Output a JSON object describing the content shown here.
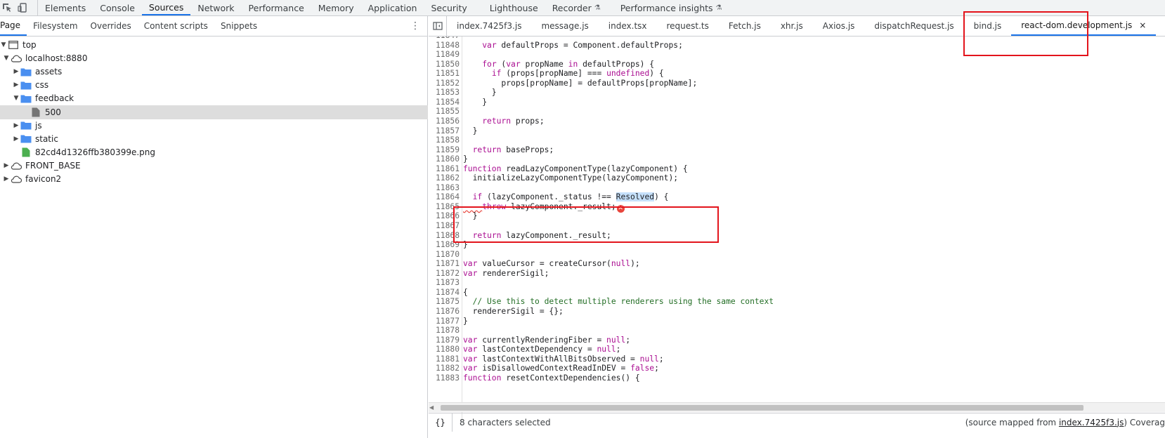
{
  "toolbar": {
    "tabs": [
      "Elements",
      "Console",
      "Sources",
      "Network",
      "Performance",
      "Memory",
      "Application",
      "Security",
      "Lighthouse",
      "Recorder",
      "Performance insights"
    ],
    "active_tab": "Sources",
    "accent": "#1a73e8"
  },
  "navigator": {
    "tabs": [
      "Page",
      "Filesystem",
      "Overrides",
      "Content scripts",
      "Snippets"
    ],
    "active_tab": "Page",
    "tree": [
      {
        "label": "top",
        "icon": "frame-icon",
        "expanded": true
      },
      {
        "label": "localhost:8880",
        "icon": "cloud-icon",
        "expanded": true
      },
      {
        "label": "assets",
        "icon": "folder-icon",
        "expanded": false
      },
      {
        "label": "css",
        "icon": "folder-icon",
        "expanded": false
      },
      {
        "label": "feedback",
        "icon": "folder-icon",
        "expanded": true
      },
      {
        "label": "500",
        "icon": "file-icon",
        "selected": true
      },
      {
        "label": "js",
        "icon": "folder-icon",
        "expanded": false
      },
      {
        "label": "static",
        "icon": "folder-icon",
        "expanded": false
      },
      {
        "label": "82cd4d1326ffb380399e.png",
        "icon": "image-file-icon"
      },
      {
        "label": "FRONT_BASE",
        "icon": "cloud-icon",
        "expanded": false
      },
      {
        "label": "favicon2",
        "icon": "cloud-icon",
        "expanded": false
      }
    ]
  },
  "editor": {
    "file_tabs": [
      "index.7425f3.js",
      "message.js",
      "index.tsx",
      "request.ts",
      "Fetch.js",
      "xhr.js",
      "Axios.js",
      "dispatchRequest.js",
      "bind.js",
      "react-dom.development.js"
    ],
    "active_file": "react-dom.development.js",
    "close_label": "×",
    "lines": [
      {
        "n": "11847",
        "code": ""
      },
      {
        "n": "11848",
        "code": "    var defaultProps = Component.defaultProps;"
      },
      {
        "n": "11849",
        "code": ""
      },
      {
        "n": "11850",
        "code": "    for (var propName in defaultProps) {"
      },
      {
        "n": "11851",
        "code": "      if (props[propName] === undefined) {"
      },
      {
        "n": "11852",
        "code": "        props[propName] = defaultProps[propName];"
      },
      {
        "n": "11853",
        "code": "      }"
      },
      {
        "n": "11854",
        "code": "    }"
      },
      {
        "n": "11855",
        "code": ""
      },
      {
        "n": "11856",
        "code": "    return props;"
      },
      {
        "n": "11857",
        "code": "  }"
      },
      {
        "n": "11858",
        "code": ""
      },
      {
        "n": "11859",
        "code": "  return baseProps;"
      },
      {
        "n": "11860",
        "code": "}"
      },
      {
        "n": "11861",
        "code": "function readLazyComponentType(lazyComponent) {"
      },
      {
        "n": "11862",
        "code": "  initializeLazyComponentType(lazyComponent);"
      },
      {
        "n": "11863",
        "code": ""
      },
      {
        "n": "11864",
        "code": "  if (lazyComponent._status !== Resolved) {"
      },
      {
        "n": "11865",
        "code": "    throw lazyComponent._result;"
      },
      {
        "n": "11866",
        "code": "  }"
      },
      {
        "n": "11867",
        "code": ""
      },
      {
        "n": "11868",
        "code": "  return lazyComponent._result;"
      },
      {
        "n": "11869",
        "code": "}"
      },
      {
        "n": "11870",
        "code": ""
      },
      {
        "n": "11871",
        "code": "var valueCursor = createCursor(null);"
      },
      {
        "n": "11872",
        "code": "var rendererSigil;"
      },
      {
        "n": "11873",
        "code": ""
      },
      {
        "n": "11874",
        "code": "{"
      },
      {
        "n": "11875",
        "code": "  // Use this to detect multiple renderers using the same context"
      },
      {
        "n": "11876",
        "code": "  rendererSigil = {};"
      },
      {
        "n": "11877",
        "code": "}"
      },
      {
        "n": "11878",
        "code": ""
      },
      {
        "n": "11879",
        "code": "var currentlyRenderingFiber = null;"
      },
      {
        "n": "11880",
        "code": "var lastContextDependency = null;"
      },
      {
        "n": "11881",
        "code": "var lastContextWithAllBitsObserved = null;"
      },
      {
        "n": "11882",
        "code": "var isDisallowedContextReadInDEV = false;"
      },
      {
        "n": "11883",
        "code": "function resetContextDependencies() {"
      }
    ],
    "selected_word": "Resolved",
    "error_line": "11865"
  },
  "status": {
    "selection": "8 characters selected",
    "mapped_prefix": "(source mapped from ",
    "mapped_file": "index.7425f3.js",
    "mapped_suffix": ")  Coverag"
  },
  "annotation_color": "#e3141c"
}
